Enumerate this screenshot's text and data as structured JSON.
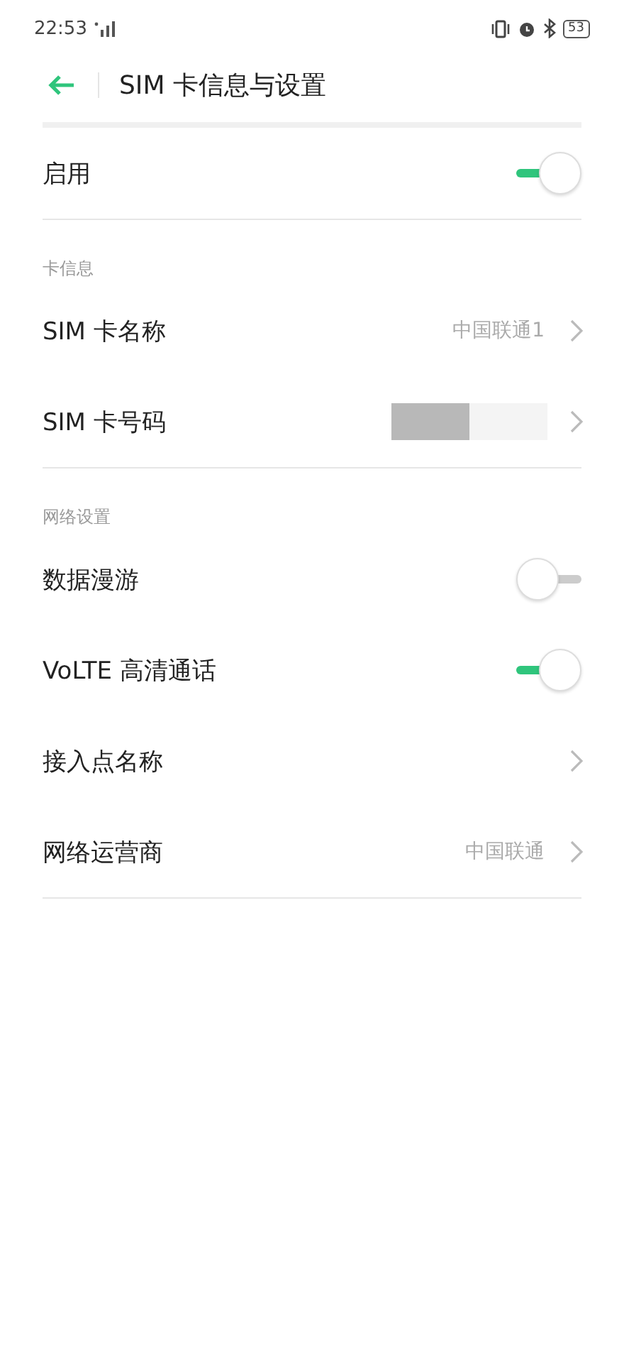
{
  "status_bar": {
    "time": "22:53",
    "battery": "53"
  },
  "header": {
    "title": "SIM 卡信息与设置"
  },
  "sections": [
    {
      "rows": [
        {
          "kind": "switch",
          "label": "启用",
          "on": true
        }
      ]
    },
    {
      "title": "卡信息",
      "rows": [
        {
          "kind": "link",
          "label": "SIM 卡名称",
          "value": "中国联通1"
        },
        {
          "kind": "redacted",
          "label": "SIM 卡号码"
        }
      ]
    },
    {
      "title": "网络设置",
      "rows": [
        {
          "kind": "switch",
          "label": "数据漫游",
          "on": false
        },
        {
          "kind": "switch",
          "label": "VoLTE 高清通话",
          "on": true
        },
        {
          "kind": "link",
          "label": "接入点名称"
        },
        {
          "kind": "link",
          "label": "网络运营商",
          "value": "中国联通"
        }
      ]
    }
  ]
}
